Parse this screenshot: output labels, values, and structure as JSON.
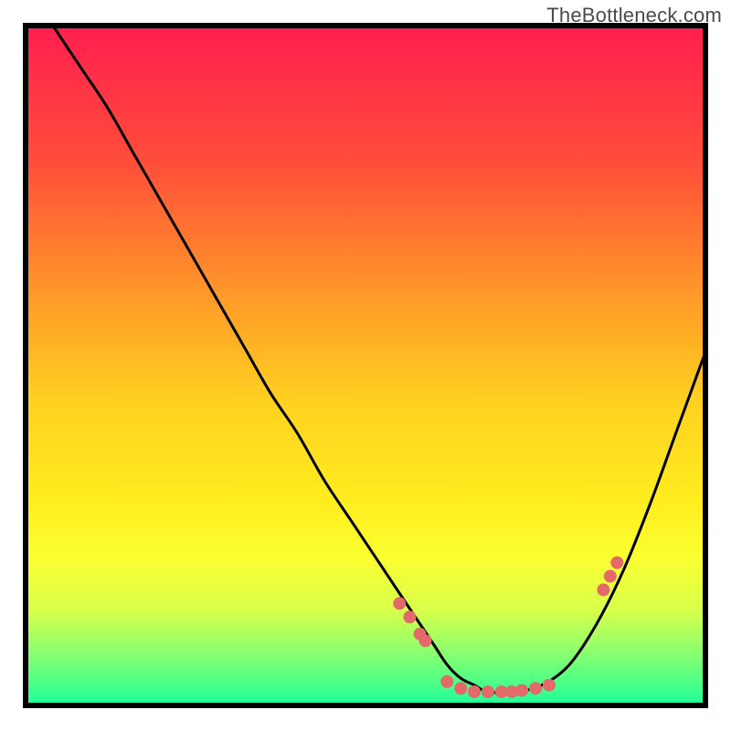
{
  "watermark": "TheBottleneck.com",
  "chart_data": {
    "type": "line",
    "title": "",
    "xlabel": "",
    "ylabel": "",
    "xlim": [
      0,
      100
    ],
    "ylim": [
      0,
      100
    ],
    "grid": false,
    "series": [
      {
        "name": "curve",
        "x": [
          4,
          8,
          12,
          16,
          20,
          24,
          28,
          32,
          36,
          40,
          44,
          48,
          52,
          56,
          60,
          62,
          64,
          66,
          68,
          72,
          76,
          80,
          84,
          88,
          92,
          96,
          100
        ],
        "y": [
          100,
          94,
          88,
          81,
          74,
          67,
          60,
          53,
          46,
          40,
          33,
          27,
          21,
          15,
          9,
          6,
          4,
          3,
          2,
          2,
          3,
          6,
          12,
          20,
          30,
          41,
          52
        ]
      }
    ],
    "points": {
      "name": "markers",
      "x": [
        55,
        56.5,
        58,
        58.8,
        62,
        64,
        66,
        68,
        70,
        71.5,
        73,
        75,
        77,
        85,
        86,
        87
      ],
      "y": [
        15,
        13,
        10.5,
        9.5,
        3.5,
        2.5,
        2,
        2,
        2,
        2,
        2.2,
        2.5,
        3,
        17,
        19,
        21
      ]
    },
    "gradient_stops": [
      {
        "offset": 0.0,
        "color": "#ff1e4f"
      },
      {
        "offset": 0.2,
        "color": "#ff4d3a"
      },
      {
        "offset": 0.4,
        "color": "#ff9a28"
      },
      {
        "offset": 0.55,
        "color": "#ffd020"
      },
      {
        "offset": 0.7,
        "color": "#ffed1f"
      },
      {
        "offset": 0.78,
        "color": "#fcff30"
      },
      {
        "offset": 0.86,
        "color": "#d8ff4a"
      },
      {
        "offset": 0.92,
        "color": "#8dff6e"
      },
      {
        "offset": 1.0,
        "color": "#1eff9a"
      }
    ]
  }
}
